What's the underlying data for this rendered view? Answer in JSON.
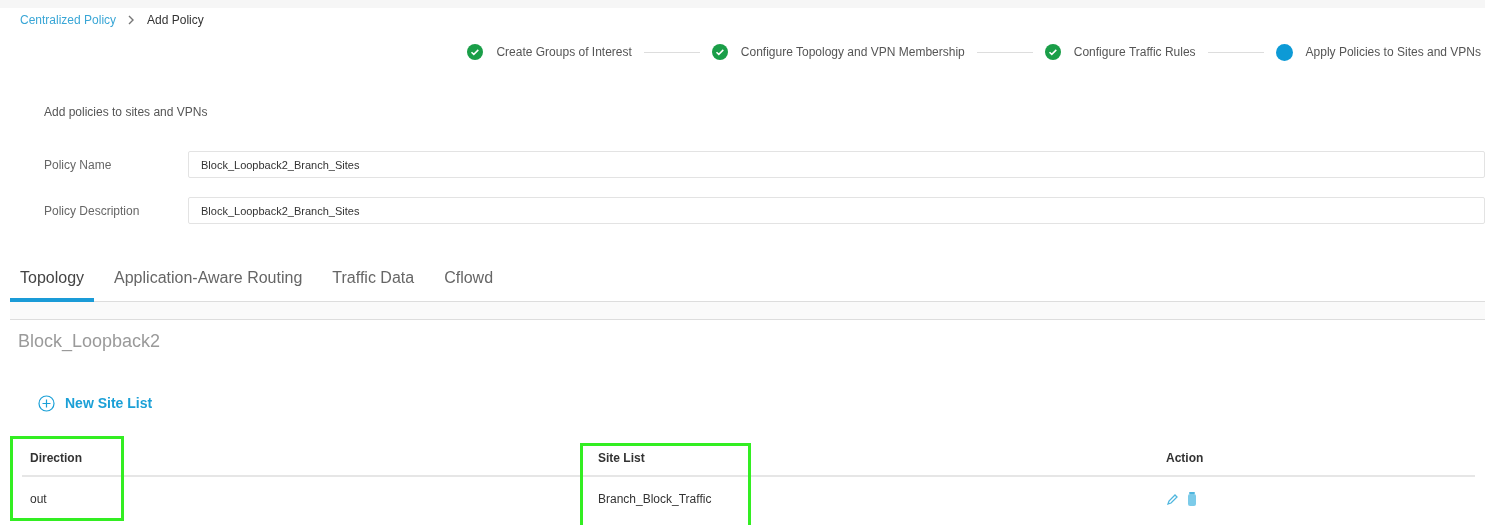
{
  "breadcrumb": [
    {
      "label": "Centralized Policy",
      "kind": "link"
    },
    {
      "label": "Add Policy",
      "kind": "current"
    }
  ],
  "steps": [
    {
      "label": "Create Groups of Interest",
      "completed": true
    },
    {
      "label": "Configure Topology and VPN Membership",
      "completed": true
    },
    {
      "label": "Configure Traffic Rules",
      "completed": true
    },
    {
      "label": "Apply Policies to Sites and VPNs",
      "completed": false
    }
  ],
  "section_title": "Add policies to sites and VPNs",
  "fields": [
    {
      "label": "Policy Name",
      "value": "Block_Loopback2_Branch_Sites"
    },
    {
      "label": "Policy Description",
      "value": "Block_Loopback2_Branch_Sites"
    }
  ],
  "tabs": [
    {
      "label": "Topology",
      "selected": true
    },
    {
      "label": "Application-Aware Routing",
      "selected": false
    },
    {
      "label": "Traffic Data",
      "selected": false
    },
    {
      "label": "Cflowd",
      "selected": false
    }
  ],
  "policy_title": "Block_Loopback2",
  "new_button": "New Site List",
  "table": {
    "columns": [
      {
        "label": "Direction",
        "highlighted": true
      },
      {
        "label": "Site List",
        "highlighted": true
      },
      {
        "label": "Action",
        "highlighted": false
      }
    ],
    "rows": [
      {
        "cells": [
          "out",
          "Branch_Block_Traffic"
        ]
      }
    ]
  }
}
